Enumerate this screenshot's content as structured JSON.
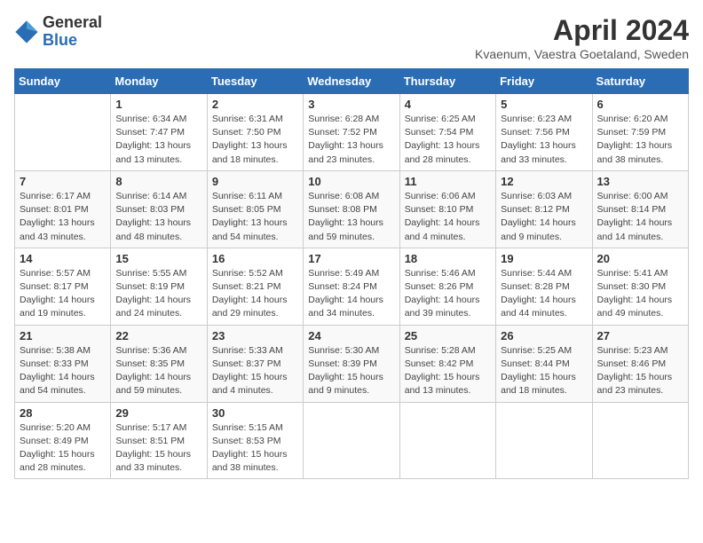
{
  "header": {
    "logo_general": "General",
    "logo_blue": "Blue",
    "month_title": "April 2024",
    "subtitle": "Kvaenum, Vaestra Goetaland, Sweden"
  },
  "days_of_week": [
    "Sunday",
    "Monday",
    "Tuesday",
    "Wednesday",
    "Thursday",
    "Friday",
    "Saturday"
  ],
  "weeks": [
    [
      {
        "day": "",
        "info": ""
      },
      {
        "day": "1",
        "info": "Sunrise: 6:34 AM\nSunset: 7:47 PM\nDaylight: 13 hours\nand 13 minutes."
      },
      {
        "day": "2",
        "info": "Sunrise: 6:31 AM\nSunset: 7:50 PM\nDaylight: 13 hours\nand 18 minutes."
      },
      {
        "day": "3",
        "info": "Sunrise: 6:28 AM\nSunset: 7:52 PM\nDaylight: 13 hours\nand 23 minutes."
      },
      {
        "day": "4",
        "info": "Sunrise: 6:25 AM\nSunset: 7:54 PM\nDaylight: 13 hours\nand 28 minutes."
      },
      {
        "day": "5",
        "info": "Sunrise: 6:23 AM\nSunset: 7:56 PM\nDaylight: 13 hours\nand 33 minutes."
      },
      {
        "day": "6",
        "info": "Sunrise: 6:20 AM\nSunset: 7:59 PM\nDaylight: 13 hours\nand 38 minutes."
      }
    ],
    [
      {
        "day": "7",
        "info": "Sunrise: 6:17 AM\nSunset: 8:01 PM\nDaylight: 13 hours\nand 43 minutes."
      },
      {
        "day": "8",
        "info": "Sunrise: 6:14 AM\nSunset: 8:03 PM\nDaylight: 13 hours\nand 48 minutes."
      },
      {
        "day": "9",
        "info": "Sunrise: 6:11 AM\nSunset: 8:05 PM\nDaylight: 13 hours\nand 54 minutes."
      },
      {
        "day": "10",
        "info": "Sunrise: 6:08 AM\nSunset: 8:08 PM\nDaylight: 13 hours\nand 59 minutes."
      },
      {
        "day": "11",
        "info": "Sunrise: 6:06 AM\nSunset: 8:10 PM\nDaylight: 14 hours\nand 4 minutes."
      },
      {
        "day": "12",
        "info": "Sunrise: 6:03 AM\nSunset: 8:12 PM\nDaylight: 14 hours\nand 9 minutes."
      },
      {
        "day": "13",
        "info": "Sunrise: 6:00 AM\nSunset: 8:14 PM\nDaylight: 14 hours\nand 14 minutes."
      }
    ],
    [
      {
        "day": "14",
        "info": "Sunrise: 5:57 AM\nSunset: 8:17 PM\nDaylight: 14 hours\nand 19 minutes."
      },
      {
        "day": "15",
        "info": "Sunrise: 5:55 AM\nSunset: 8:19 PM\nDaylight: 14 hours\nand 24 minutes."
      },
      {
        "day": "16",
        "info": "Sunrise: 5:52 AM\nSunset: 8:21 PM\nDaylight: 14 hours\nand 29 minutes."
      },
      {
        "day": "17",
        "info": "Sunrise: 5:49 AM\nSunset: 8:24 PM\nDaylight: 14 hours\nand 34 minutes."
      },
      {
        "day": "18",
        "info": "Sunrise: 5:46 AM\nSunset: 8:26 PM\nDaylight: 14 hours\nand 39 minutes."
      },
      {
        "day": "19",
        "info": "Sunrise: 5:44 AM\nSunset: 8:28 PM\nDaylight: 14 hours\nand 44 minutes."
      },
      {
        "day": "20",
        "info": "Sunrise: 5:41 AM\nSunset: 8:30 PM\nDaylight: 14 hours\nand 49 minutes."
      }
    ],
    [
      {
        "day": "21",
        "info": "Sunrise: 5:38 AM\nSunset: 8:33 PM\nDaylight: 14 hours\nand 54 minutes."
      },
      {
        "day": "22",
        "info": "Sunrise: 5:36 AM\nSunset: 8:35 PM\nDaylight: 14 hours\nand 59 minutes."
      },
      {
        "day": "23",
        "info": "Sunrise: 5:33 AM\nSunset: 8:37 PM\nDaylight: 15 hours\nand 4 minutes."
      },
      {
        "day": "24",
        "info": "Sunrise: 5:30 AM\nSunset: 8:39 PM\nDaylight: 15 hours\nand 9 minutes."
      },
      {
        "day": "25",
        "info": "Sunrise: 5:28 AM\nSunset: 8:42 PM\nDaylight: 15 hours\nand 13 minutes."
      },
      {
        "day": "26",
        "info": "Sunrise: 5:25 AM\nSunset: 8:44 PM\nDaylight: 15 hours\nand 18 minutes."
      },
      {
        "day": "27",
        "info": "Sunrise: 5:23 AM\nSunset: 8:46 PM\nDaylight: 15 hours\nand 23 minutes."
      }
    ],
    [
      {
        "day": "28",
        "info": "Sunrise: 5:20 AM\nSunset: 8:49 PM\nDaylight: 15 hours\nand 28 minutes."
      },
      {
        "day": "29",
        "info": "Sunrise: 5:17 AM\nSunset: 8:51 PM\nDaylight: 15 hours\nand 33 minutes."
      },
      {
        "day": "30",
        "info": "Sunrise: 5:15 AM\nSunset: 8:53 PM\nDaylight: 15 hours\nand 38 minutes."
      },
      {
        "day": "",
        "info": ""
      },
      {
        "day": "",
        "info": ""
      },
      {
        "day": "",
        "info": ""
      },
      {
        "day": "",
        "info": ""
      }
    ]
  ]
}
